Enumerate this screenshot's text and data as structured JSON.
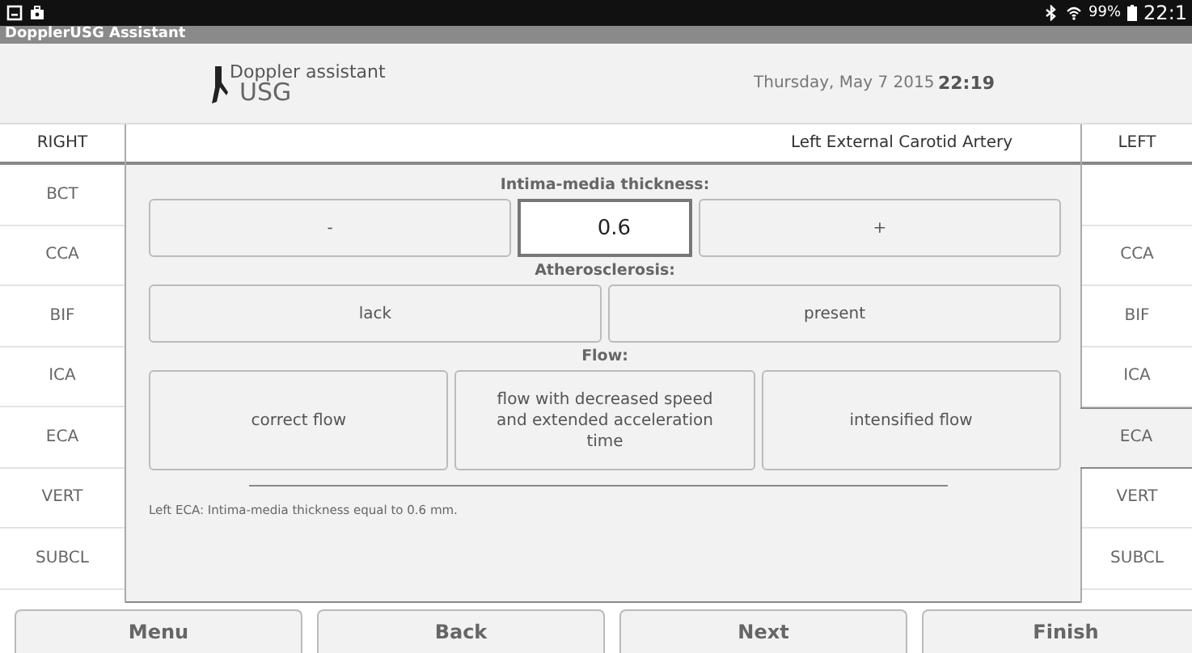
{
  "status_bar": {
    "battery": "99%",
    "time": "22:1"
  },
  "app_title": "DopplerUSG Assistant",
  "header": {
    "logo_line1": "Doppler assistant",
    "logo_line2": "USG",
    "date": "Thursday, May 7 2015",
    "time": "22:19"
  },
  "page_title": "Left External Carotid Artery",
  "right_side": {
    "label": "RIGHT",
    "items": [
      {
        "label": "BCT",
        "selected": false
      },
      {
        "label": "CCA",
        "selected": false
      },
      {
        "label": "BIF",
        "selected": false
      },
      {
        "label": "ICA",
        "selected": false
      },
      {
        "label": "ECA",
        "selected": false
      },
      {
        "label": "VERT",
        "selected": false
      },
      {
        "label": "SUBCL",
        "selected": false
      }
    ]
  },
  "left_side": {
    "label": "LEFT",
    "items": [
      {
        "label": "CCA",
        "selected": false
      },
      {
        "label": "BIF",
        "selected": false
      },
      {
        "label": "ICA",
        "selected": false
      },
      {
        "label": "ECA",
        "selected": true
      },
      {
        "label": "VERT",
        "selected": false
      },
      {
        "label": "SUBCL",
        "selected": false
      }
    ]
  },
  "sections": [
    {
      "kind": "stepper",
      "label": "Intima-media thickness:",
      "minus": "-",
      "value": "0.6",
      "plus": "+"
    },
    {
      "kind": "choices",
      "label": "Atherosclerosis:",
      "options": [
        {
          "label": "lack",
          "selected": false
        },
        {
          "label": "present",
          "selected": false
        }
      ]
    },
    {
      "kind": "choices",
      "label": "Flow:",
      "options": [
        {
          "label": "correct flow",
          "selected": false
        },
        {
          "label": "flow with decreased speed and extended acceleration time",
          "selected": false
        },
        {
          "label": "intensified flow",
          "selected": false
        }
      ]
    }
  ],
  "summary": "Left ECA: Intima-media thickness equal to 0.6 mm.",
  "nav_buttons": [
    "Menu",
    "Back",
    "Next",
    "Finish"
  ]
}
